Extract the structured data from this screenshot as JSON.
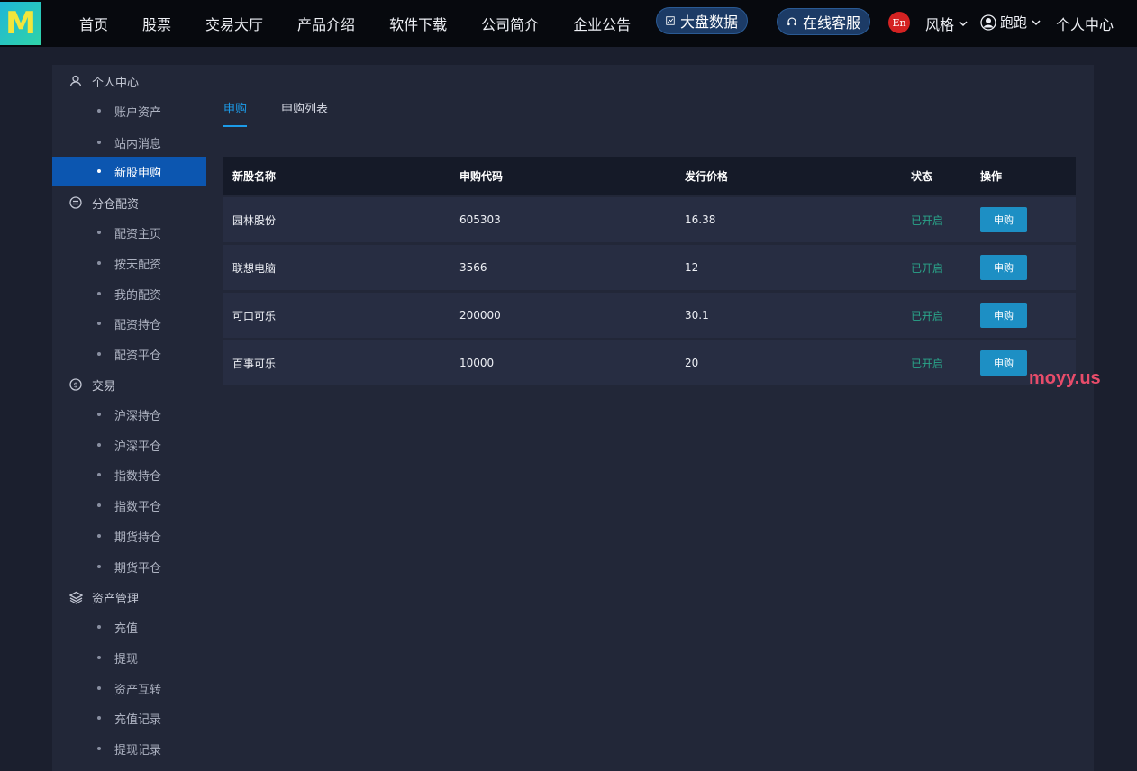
{
  "header": {
    "logo_text": "M",
    "nav": [
      "首页",
      "股票",
      "交易大厅",
      "产品介绍",
      "软件下载",
      "公司简介",
      "企业公告"
    ],
    "market_data": "大盘数据",
    "online_service": "在线客服",
    "lang": "En",
    "style_label": "风格",
    "username": "跑跑",
    "center_link": "个人中心"
  },
  "sidebar": {
    "groups": [
      {
        "title": "个人中心",
        "icon": "user-icon",
        "items": [
          "账户资产",
          "站内消息",
          "新股申购"
        ]
      },
      {
        "title": "分仓配资",
        "icon": "equal-circle-icon",
        "items": [
          "配资主页",
          "按天配资",
          "我的配资",
          "配资持仓",
          "配资平仓"
        ]
      },
      {
        "title": "交易",
        "icon": "coin-icon",
        "items": [
          "沪深持仓",
          "沪深平仓",
          "指数持仓",
          "指数平仓",
          "期货持仓",
          "期货平仓"
        ]
      },
      {
        "title": "资产管理",
        "icon": "layers-icon",
        "items": [
          "充值",
          "提现",
          "资产互转",
          "充值记录",
          "提现记录"
        ]
      }
    ],
    "active_item": "新股申购"
  },
  "tabs": [
    "申购",
    "申购列表"
  ],
  "table": {
    "headers": [
      "新股名称",
      "申购代码",
      "发行价格",
      "状态",
      "操作"
    ],
    "rows": [
      {
        "name": "园林股份",
        "code": "605303",
        "price": "16.38",
        "status": "已开启",
        "action": "申购"
      },
      {
        "name": "联想电脑",
        "code": "3566",
        "price": "12",
        "status": "已开启",
        "action": "申购"
      },
      {
        "name": "可口可乐",
        "code": "200000",
        "price": "30.1",
        "status": "已开启",
        "action": "申购"
      },
      {
        "name": "百事可乐",
        "code": "10000",
        "price": "20",
        "status": "已开启",
        "action": "申购"
      }
    ]
  },
  "watermark": "moyy.us",
  "colors": {
    "accent": "#1c9be8",
    "active_bg": "#0c56b0",
    "status": "#2aa58a",
    "button": "#1d8fc4"
  }
}
